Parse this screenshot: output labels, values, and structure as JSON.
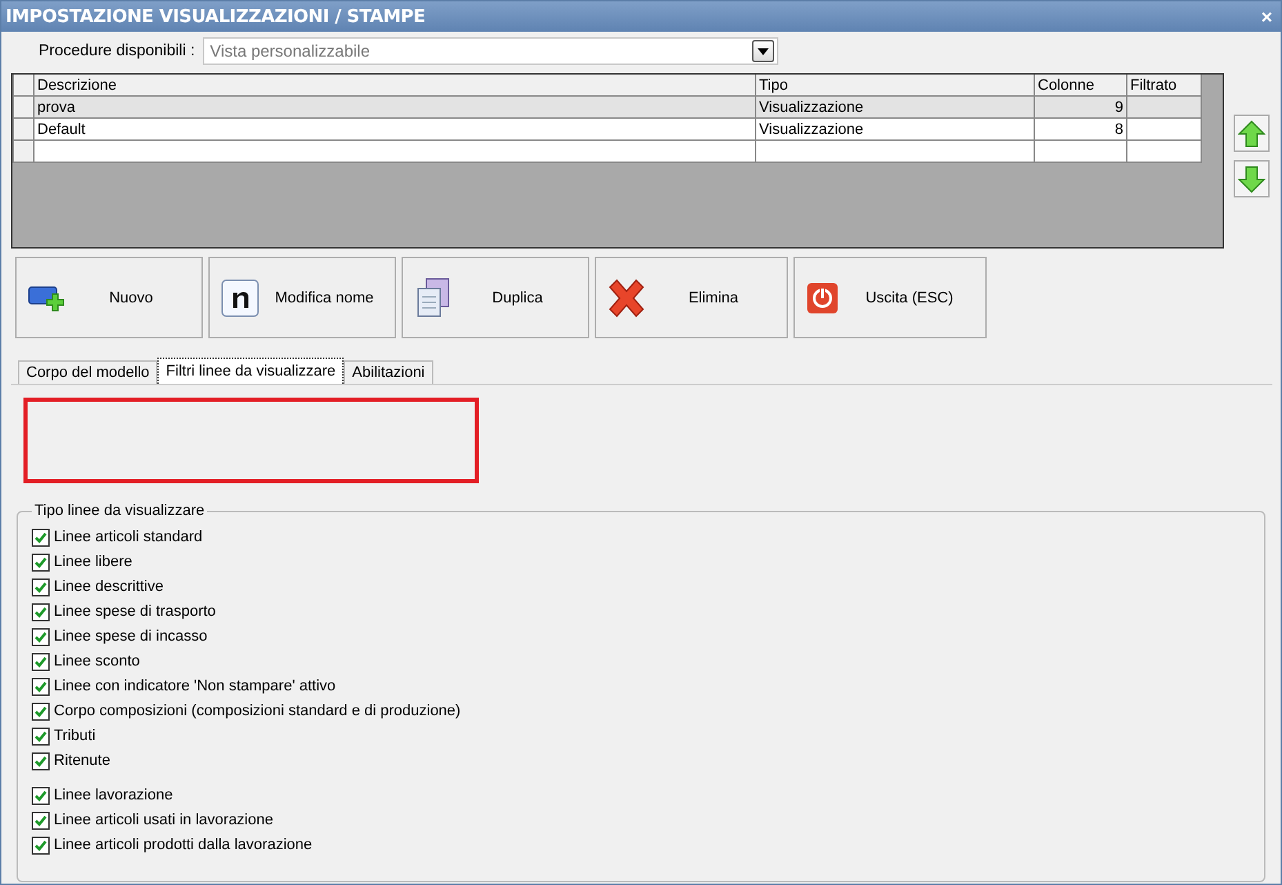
{
  "window": {
    "title": "IMPOSTAZIONE VISUALIZZAZIONI / STAMPE",
    "close": "×"
  },
  "procedure": {
    "label": "Procedure disponibili :",
    "value": "Vista personalizzabile"
  },
  "table": {
    "columns": [
      "Descrizione",
      "Tipo",
      "Colonne",
      "Filtrato"
    ],
    "rows": [
      {
        "cells": [
          "prova",
          "Visualizzazione",
          "9",
          ""
        ],
        "selected": true
      },
      {
        "cells": [
          "Default",
          "Visualizzazione",
          "8",
          ""
        ],
        "selected": false
      }
    ]
  },
  "buttons": [
    {
      "label": "Nuovo",
      "kind": "new"
    },
    {
      "label": "Modifica nome",
      "kind": "rename"
    },
    {
      "label": "Duplica",
      "kind": "duplicate"
    },
    {
      "label": "Elimina",
      "kind": "delete"
    },
    {
      "label": "Uscita (ESC)",
      "kind": "exit"
    }
  ],
  "tabs": [
    {
      "label": "Corpo del modello",
      "selected": false
    },
    {
      "label": "Filtri linee da visualizzare",
      "selected": true
    },
    {
      "label": "Abilitazioni",
      "selected": false
    }
  ],
  "group": {
    "title": "Tipo linee da visualizzare",
    "sections": [
      [
        {
          "label": "Linee articoli standard",
          "checked": true
        },
        {
          "label": "Linee libere",
          "checked": true
        },
        {
          "label": "Linee descrittive",
          "checked": true
        },
        {
          "label": "Linee spese di trasporto",
          "checked": true
        },
        {
          "label": "Linee spese di incasso",
          "checked": true
        },
        {
          "label": "Linee sconto",
          "checked": true
        },
        {
          "label": "Linee con indicatore 'Non stampare' attivo",
          "checked": true
        },
        {
          "label": "Corpo composizioni (composizioni standard e di produzione)",
          "checked": true
        },
        {
          "label": "Tributi",
          "checked": true
        },
        {
          "label": "Ritenute",
          "checked": true
        }
      ],
      [
        {
          "label": "Linee lavorazione",
          "checked": true
        },
        {
          "label": "Linee articoli usati in lavorazione",
          "checked": true
        },
        {
          "label": "Linee articoli prodotti dalla lavorazione",
          "checked": true
        }
      ]
    ]
  }
}
